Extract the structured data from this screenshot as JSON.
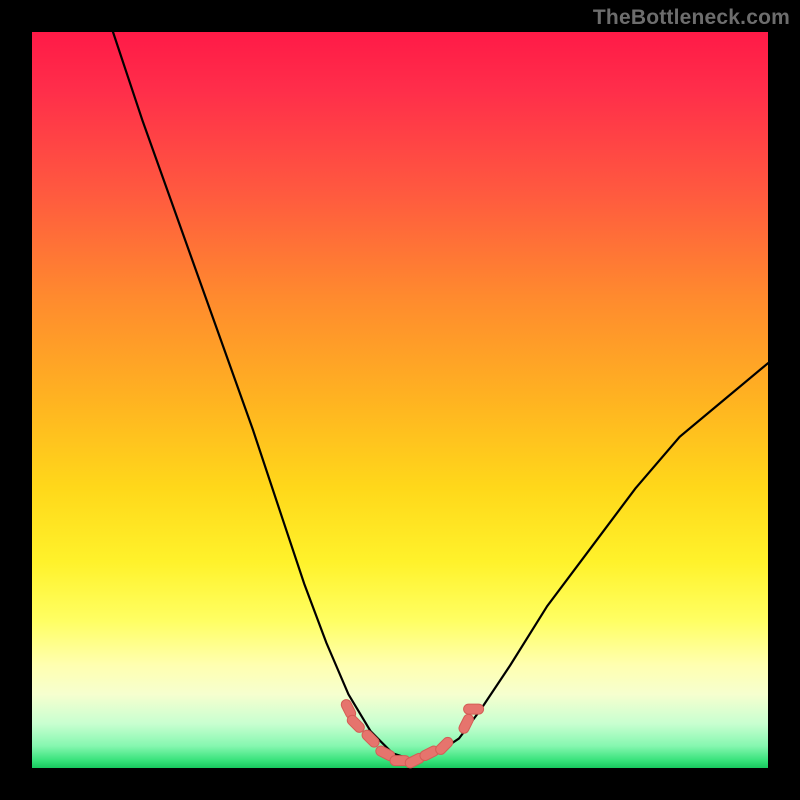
{
  "watermark": {
    "text": "TheBottleneck.com"
  },
  "colors": {
    "frame_background": "#000000",
    "curve_stroke": "#000000",
    "marker_fill": "#e6746d",
    "marker_stroke": "#d45d56",
    "gradient_top": "#ff1a47",
    "gradient_bottom": "#18c85e"
  },
  "chart_data": {
    "type": "line",
    "title": "",
    "xlabel": "",
    "ylabel": "",
    "xlim": [
      0,
      100
    ],
    "ylim": [
      0,
      100
    ],
    "note": "Axes are unlabeled; x and y approximated as 0–100 percent of plot area. Curve read from pixel positions: steep descent from top-left, reaches near-zero minimum around x≈46–56, then rises toward right edge to roughly y≈55.",
    "series": [
      {
        "name": "curve",
        "x": [
          11,
          15,
          20,
          25,
          30,
          34,
          37,
          40,
          43,
          46,
          49,
          52,
          55,
          58,
          61,
          65,
          70,
          76,
          82,
          88,
          94,
          100
        ],
        "y": [
          100,
          88,
          74,
          60,
          46,
          34,
          25,
          17,
          10,
          5,
          2,
          1,
          2,
          4,
          8,
          14,
          22,
          30,
          38,
          45,
          50,
          55
        ]
      }
    ],
    "markers": {
      "name": "highlighted-points",
      "note": "Clustered salmon/pink rounded markers near the curve's minimum, approximate positions.",
      "points": [
        {
          "x": 43,
          "y": 8
        },
        {
          "x": 44,
          "y": 6
        },
        {
          "x": 46,
          "y": 4
        },
        {
          "x": 48,
          "y": 2
        },
        {
          "x": 50,
          "y": 1
        },
        {
          "x": 52,
          "y": 1
        },
        {
          "x": 54,
          "y": 2
        },
        {
          "x": 56,
          "y": 3
        },
        {
          "x": 59,
          "y": 6
        },
        {
          "x": 60,
          "y": 8
        }
      ]
    }
  }
}
